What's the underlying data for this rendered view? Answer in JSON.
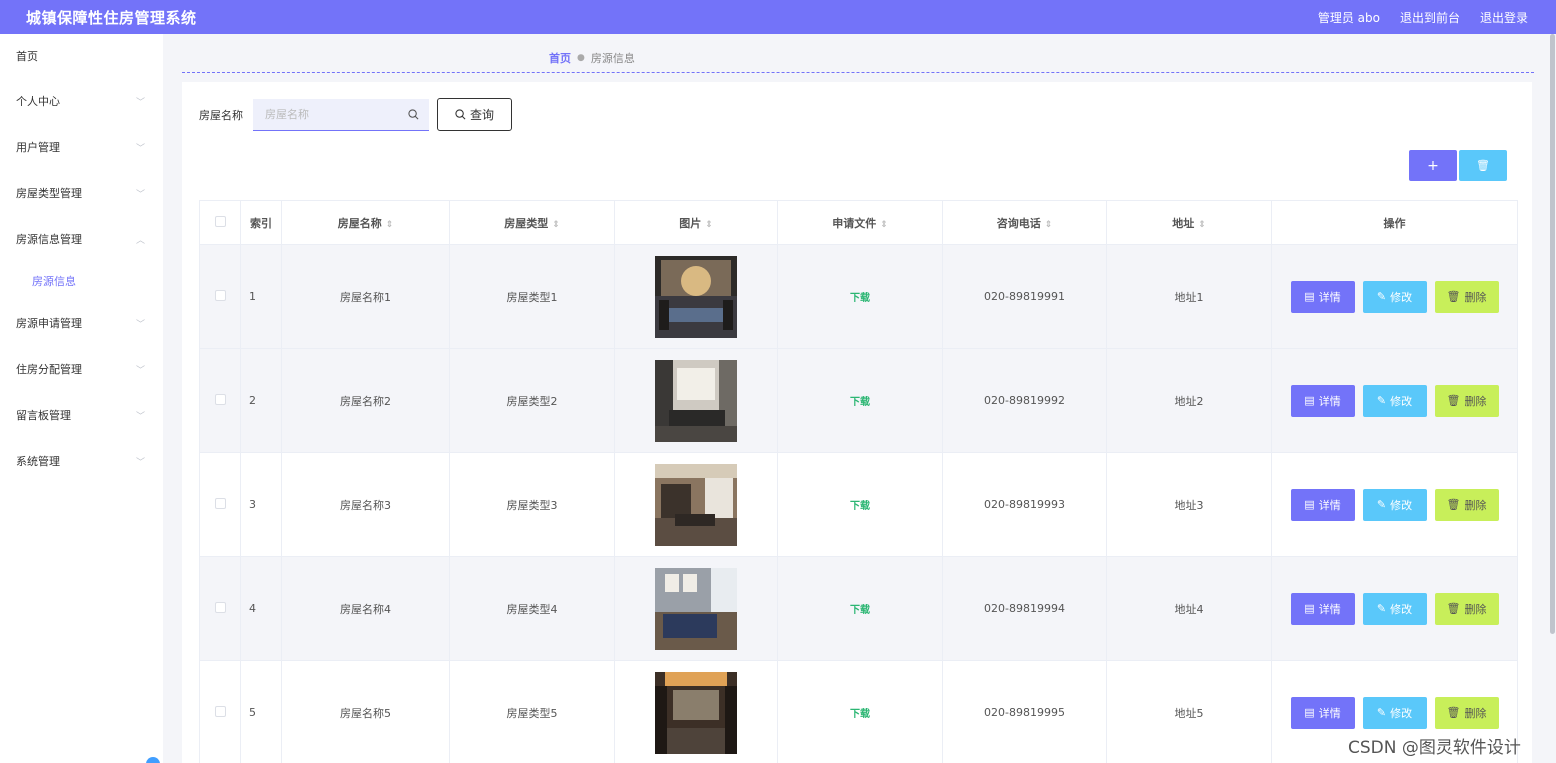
{
  "header": {
    "title": "城镇保障性住房管理系统",
    "user": "管理员 abo",
    "to_front": "退出到前台",
    "logout": "退出登录"
  },
  "sidebar": {
    "items": [
      {
        "label": "首页"
      },
      {
        "label": "个人中心"
      },
      {
        "label": "用户管理"
      },
      {
        "label": "房屋类型管理"
      },
      {
        "label": "房源信息管理"
      },
      {
        "label": "房源申请管理"
      },
      {
        "label": "住房分配管理"
      },
      {
        "label": "留言板管理"
      },
      {
        "label": "系统管理"
      }
    ],
    "sub_item": "房源信息"
  },
  "breadcrumb": {
    "home": "首页",
    "current": "房源信息"
  },
  "search": {
    "label": "房屋名称",
    "placeholder": "房屋名称",
    "button": "查询"
  },
  "toolbar": {
    "add": "+",
    "delete": "🗑"
  },
  "table": {
    "columns": [
      "索引",
      "房屋名称",
      "房屋类型",
      "图片",
      "申请文件",
      "咨询电话",
      "地址",
      "操作"
    ],
    "rows": [
      {
        "index": "1",
        "name": "房屋名称1",
        "type": "房屋类型1",
        "file": "下载",
        "phone": "020-89819991",
        "address": "地址1"
      },
      {
        "index": "2",
        "name": "房屋名称2",
        "type": "房屋类型2",
        "file": "下载",
        "phone": "020-89819992",
        "address": "地址2"
      },
      {
        "index": "3",
        "name": "房屋名称3",
        "type": "房屋类型3",
        "file": "下载",
        "phone": "020-89819993",
        "address": "地址3"
      },
      {
        "index": "4",
        "name": "房屋名称4",
        "type": "房屋类型4",
        "file": "下载",
        "phone": "020-89819994",
        "address": "地址4"
      },
      {
        "index": "5",
        "name": "房屋名称5",
        "type": "房屋类型5",
        "file": "下载",
        "phone": "020-89819995",
        "address": "地址5"
      }
    ],
    "actions": {
      "detail": "详情",
      "edit": "修改",
      "delete": "删除"
    }
  },
  "watermark": "CSDN @图灵软件设计",
  "colors": {
    "primary": "#7373f9",
    "edit": "#5ac8fa",
    "delete": "#c8ef5a",
    "download": "#2bb673"
  }
}
